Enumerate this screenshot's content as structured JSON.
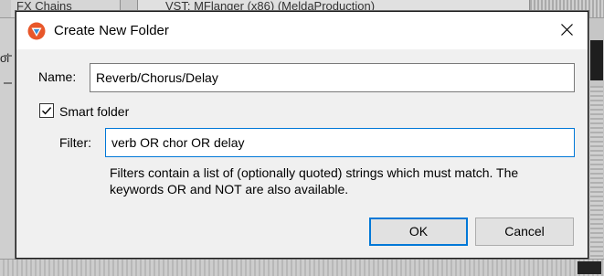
{
  "background": {
    "tab_a": "FX Chains",
    "tab_b": "VST: MFlanger (x86) (MeldaProduction)",
    "left_text": "ol"
  },
  "dialog": {
    "title": "Create New Folder",
    "name_label": "Name:",
    "name_value": "Reverb/Chorus/Delay",
    "smart_folder_label": "Smart folder",
    "smart_folder_checked": true,
    "filter_label": "Filter:",
    "filter_value": "verb OR chor OR delay",
    "help_line_1": "Filters contain a list of (optionally quoted) strings which must match. The",
    "help_line_2": "keywords OR and NOT are also available.",
    "ok_label": "OK",
    "cancel_label": "Cancel",
    "accent_color": "#0078d7"
  },
  "icons": {
    "app": "reaper-logo-icon",
    "close": "close-icon",
    "check": "checkmark-icon"
  }
}
